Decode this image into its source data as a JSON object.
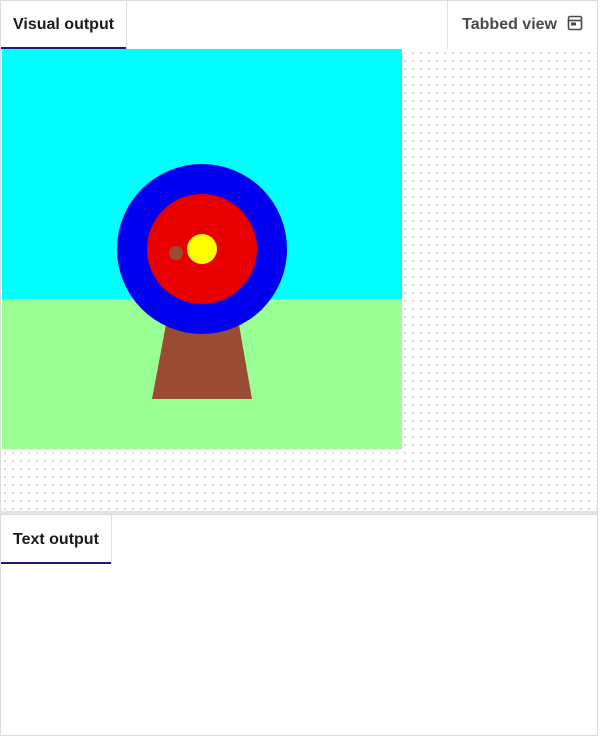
{
  "visual_panel": {
    "tab_label": "Visual output",
    "tabbed_view_label": "Tabbed view"
  },
  "text_panel": {
    "tab_label": "Text output",
    "content": ""
  },
  "scene": {
    "sky_color": "#00ffff",
    "grass_color": "#99ff92",
    "stand_color": "#994c33",
    "outer_ring_color": "#0000ee",
    "middle_ring_color": "#e80000",
    "bullseye_color": "#ffff00",
    "arrow_hole_color": "#994c33"
  }
}
